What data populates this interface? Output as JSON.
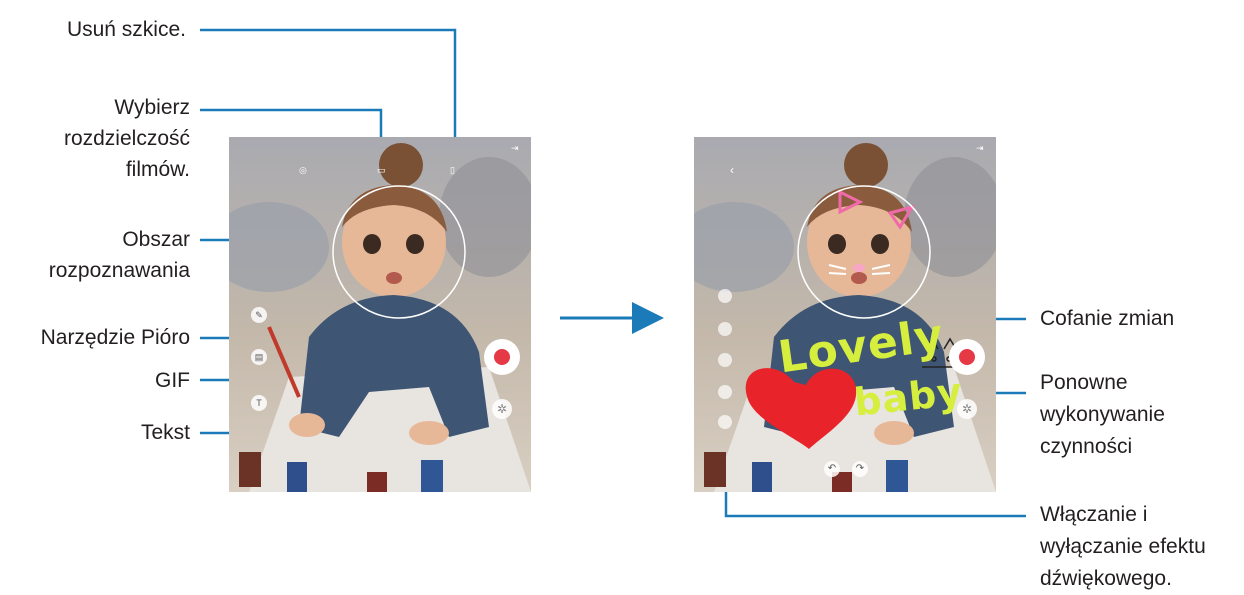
{
  "left_callouts": {
    "delete_sketch": "Usuń szkice.",
    "resolution_line1": "Wybierz",
    "resolution_line2": "rozdzielczość",
    "resolution_line3": "filmów.",
    "recognition_line1": "Obszar",
    "recognition_line2": "rozpoznawania",
    "pen_tool": "Narzędzie Pióro",
    "gif": "GIF",
    "text": "Tekst"
  },
  "right_callouts": {
    "undo": "Cofanie zmian",
    "redo_line1": "Ponowne",
    "redo_line2": "wykonywanie",
    "redo_line3": "czynności",
    "sound_line1": "Włączanie i",
    "sound_line2": "wyłączanie efektu",
    "sound_line3": "dźwiękowego."
  },
  "screen_left": {
    "toolbar_icons": [
      "settings-icon",
      "resolution-icon",
      "trash-icon",
      "exit-icon"
    ],
    "side_tools": [
      "pen-icon",
      "gif-icon",
      "text-icon"
    ],
    "record_color": "#e63946"
  },
  "screen_right": {
    "doodle_line1": "Lovely",
    "doodle_line2": "baby",
    "doodle_color": "#d6ee3e",
    "heart_color": "#e8232a",
    "side_tools": [
      "pen-icon",
      "brush-icon",
      "eraser-icon",
      "color-icon",
      "sound-icon"
    ],
    "bottom_controls": [
      "undo-icon",
      "redo-icon"
    ],
    "record_color": "#e63946"
  },
  "colors": {
    "leader_line": "#1b7ab8",
    "flow_arrow": "#1b7ab8",
    "label_text": "#231f20"
  }
}
